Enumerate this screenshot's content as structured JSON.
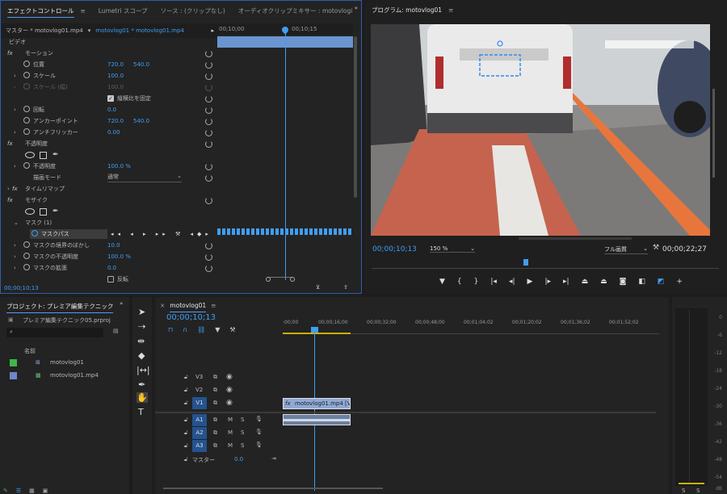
{
  "effect_panel": {
    "tabs": [
      "エフェクトコントロール",
      "Lumetri スコープ",
      "ソース : (クリップなし)",
      "オーディオクリップミキサー : motovlogi"
    ],
    "master": "マスター * motovlog01.mp4",
    "clip": "motovlog01 * motovlog01.mp4",
    "ruler": [
      "00;10;00",
      "00;10;15"
    ],
    "video_header": "ビデオ",
    "rows": [
      {
        "label": "モーション",
        "indent": 1,
        "fx": true
      },
      {
        "label": "位置",
        "indent": 2,
        "v1": "720.0",
        "v2": "540.0"
      },
      {
        "label": "スケール",
        "indent": 2,
        "v1": "100.0"
      },
      {
        "label": "スケール (幅)",
        "indent": 2,
        "v1": "100.0",
        "dim": true
      },
      {
        "label": "縦横比を固定",
        "indent": 4,
        "check": true
      },
      {
        "label": "回転",
        "indent": 2,
        "v1": "0.0"
      },
      {
        "label": "アンカーポイント",
        "indent": 2,
        "v1": "720.0",
        "v2": "540.0"
      },
      {
        "label": "アンチフリッカー",
        "indent": 2,
        "v1": "0.00"
      },
      {
        "label": "不透明度",
        "indent": 1,
        "fx": true
      },
      {
        "label": "shapes",
        "indent": 2
      },
      {
        "label": "不透明度",
        "indent": 2,
        "v1": "100.0 %"
      },
      {
        "label": "描画モード",
        "indent": 3,
        "select": "通常"
      },
      {
        "label": "タイムリマップ",
        "indent": 1,
        "fx": true
      },
      {
        "label": "モザイク",
        "indent": 1,
        "fx": true
      },
      {
        "label": "shapes",
        "indent": 2
      },
      {
        "label": "マスク (1)",
        "indent": 2
      },
      {
        "label": "マスクパス",
        "indent": 3,
        "maskpath": true
      },
      {
        "label": "マスクの境界のぼかし",
        "indent": 2,
        "v1": "10.0"
      },
      {
        "label": "マスクの不透明度",
        "indent": 2,
        "v1": "100.0 %"
      },
      {
        "label": "マスクの拡張",
        "indent": 2,
        "v1": "0.0"
      },
      {
        "label": "反転",
        "indent": 4,
        "check": false
      }
    ],
    "timecode": "00;00;10;13"
  },
  "program": {
    "title": "プログラム: motovlog01",
    "timecode": "00;00;10;13",
    "zoom": "150 %",
    "quality": "フル画質",
    "duration": "00;00;22;27"
  },
  "project": {
    "title": "プロジェクト: プレミア編集テクニック",
    "file": "プレミア編集テクニック05.prproj",
    "col": "名前",
    "items": [
      "motovlog01",
      "motovlog01.mp4"
    ],
    "colors": [
      "#3fb54a",
      "#6f86c8"
    ]
  },
  "timeline": {
    "title": "motovlog01",
    "timecode": "00;00;10;13",
    "ruler": [
      ":00;00",
      "00;00;16;00",
      "00;00;32;00",
      "00;00;48;00",
      "00;01;04;02",
      "00;01;20;02",
      "00;01;36;02",
      "00;01;52;02"
    ],
    "video": [
      "V3",
      "V2",
      "V1"
    ],
    "audio": [
      "A1",
      "A2",
      "A3"
    ],
    "master": "マスター",
    "master_val": "0.0",
    "clip": "motovlog01.mp4 [V"
  },
  "meter": [
    "0",
    "-6",
    "-12",
    "-18",
    "-24",
    "-30",
    "-36",
    "-42",
    "-48",
    "-54",
    "dB"
  ],
  "meter_foot": [
    "S",
    "S"
  ]
}
